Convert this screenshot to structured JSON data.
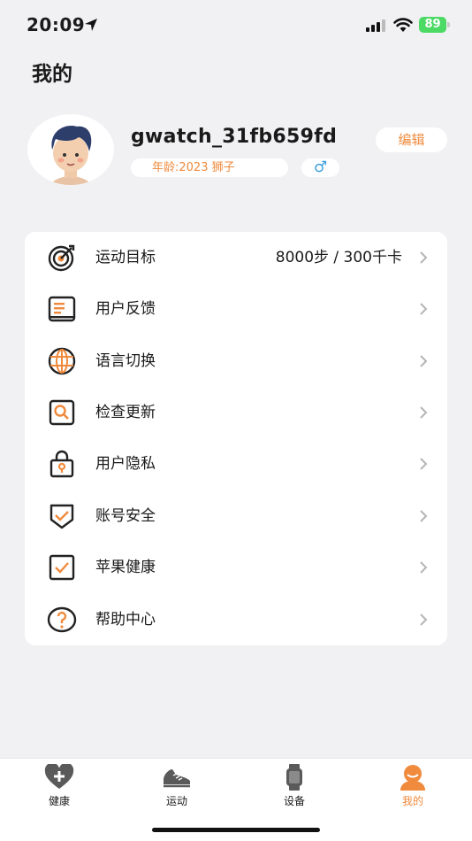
{
  "status_bar": {
    "time": "20:09",
    "battery": "89"
  },
  "page_title": "我的",
  "profile": {
    "username": "gwatch_31fb659fd",
    "edit_label": "编辑",
    "info": "年龄:2023  狮子",
    "gender_symbol": "♂"
  },
  "menu": {
    "items": [
      {
        "label": "运动目标",
        "value": "8000步 / 300千卡",
        "icon": "target-icon"
      },
      {
        "label": "用户反馈",
        "icon": "feedback-icon"
      },
      {
        "label": "语言切换",
        "icon": "globe-icon"
      },
      {
        "label": "检查更新",
        "icon": "search-update-icon"
      },
      {
        "label": "用户隐私",
        "icon": "lock-icon"
      },
      {
        "label": "账号安全",
        "icon": "shield-icon"
      },
      {
        "label": "苹果健康",
        "icon": "checkbox-icon"
      },
      {
        "label": "帮助中心",
        "icon": "question-icon"
      }
    ]
  },
  "tabs": [
    {
      "label": "健康",
      "icon": "heart-plus-icon"
    },
    {
      "label": "运动",
      "icon": "shoe-icon"
    },
    {
      "label": "设备",
      "icon": "watch-icon"
    },
    {
      "label": "我的",
      "icon": "profile-icon",
      "active": true
    }
  ],
  "colors": {
    "accent": "#f08a3c",
    "gender": "#3d9fe0",
    "battery": "#4cd964"
  }
}
